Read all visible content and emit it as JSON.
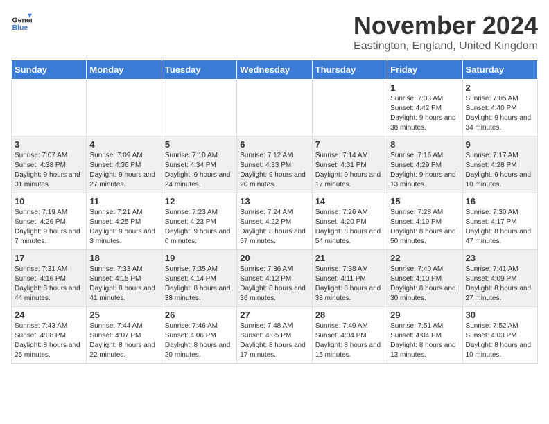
{
  "logo": {
    "line1": "General",
    "line2": "Blue"
  },
  "title": "November 2024",
  "subtitle": "Eastington, England, United Kingdom",
  "days_of_week": [
    "Sunday",
    "Monday",
    "Tuesday",
    "Wednesday",
    "Thursday",
    "Friday",
    "Saturday"
  ],
  "weeks": [
    [
      {
        "day": "",
        "sunrise": "",
        "sunset": "",
        "daylight": ""
      },
      {
        "day": "",
        "sunrise": "",
        "sunset": "",
        "daylight": ""
      },
      {
        "day": "",
        "sunrise": "",
        "sunset": "",
        "daylight": ""
      },
      {
        "day": "",
        "sunrise": "",
        "sunset": "",
        "daylight": ""
      },
      {
        "day": "",
        "sunrise": "",
        "sunset": "",
        "daylight": ""
      },
      {
        "day": "1",
        "sunrise": "Sunrise: 7:03 AM",
        "sunset": "Sunset: 4:42 PM",
        "daylight": "Daylight: 9 hours and 38 minutes."
      },
      {
        "day": "2",
        "sunrise": "Sunrise: 7:05 AM",
        "sunset": "Sunset: 4:40 PM",
        "daylight": "Daylight: 9 hours and 34 minutes."
      }
    ],
    [
      {
        "day": "3",
        "sunrise": "Sunrise: 7:07 AM",
        "sunset": "Sunset: 4:38 PM",
        "daylight": "Daylight: 9 hours and 31 minutes."
      },
      {
        "day": "4",
        "sunrise": "Sunrise: 7:09 AM",
        "sunset": "Sunset: 4:36 PM",
        "daylight": "Daylight: 9 hours and 27 minutes."
      },
      {
        "day": "5",
        "sunrise": "Sunrise: 7:10 AM",
        "sunset": "Sunset: 4:34 PM",
        "daylight": "Daylight: 9 hours and 24 minutes."
      },
      {
        "day": "6",
        "sunrise": "Sunrise: 7:12 AM",
        "sunset": "Sunset: 4:33 PM",
        "daylight": "Daylight: 9 hours and 20 minutes."
      },
      {
        "day": "7",
        "sunrise": "Sunrise: 7:14 AM",
        "sunset": "Sunset: 4:31 PM",
        "daylight": "Daylight: 9 hours and 17 minutes."
      },
      {
        "day": "8",
        "sunrise": "Sunrise: 7:16 AM",
        "sunset": "Sunset: 4:29 PM",
        "daylight": "Daylight: 9 hours and 13 minutes."
      },
      {
        "day": "9",
        "sunrise": "Sunrise: 7:17 AM",
        "sunset": "Sunset: 4:28 PM",
        "daylight": "Daylight: 9 hours and 10 minutes."
      }
    ],
    [
      {
        "day": "10",
        "sunrise": "Sunrise: 7:19 AM",
        "sunset": "Sunset: 4:26 PM",
        "daylight": "Daylight: 9 hours and 7 minutes."
      },
      {
        "day": "11",
        "sunrise": "Sunrise: 7:21 AM",
        "sunset": "Sunset: 4:25 PM",
        "daylight": "Daylight: 9 hours and 3 minutes."
      },
      {
        "day": "12",
        "sunrise": "Sunrise: 7:23 AM",
        "sunset": "Sunset: 4:23 PM",
        "daylight": "Daylight: 9 hours and 0 minutes."
      },
      {
        "day": "13",
        "sunrise": "Sunrise: 7:24 AM",
        "sunset": "Sunset: 4:22 PM",
        "daylight": "Daylight: 8 hours and 57 minutes."
      },
      {
        "day": "14",
        "sunrise": "Sunrise: 7:26 AM",
        "sunset": "Sunset: 4:20 PM",
        "daylight": "Daylight: 8 hours and 54 minutes."
      },
      {
        "day": "15",
        "sunrise": "Sunrise: 7:28 AM",
        "sunset": "Sunset: 4:19 PM",
        "daylight": "Daylight: 8 hours and 50 minutes."
      },
      {
        "day": "16",
        "sunrise": "Sunrise: 7:30 AM",
        "sunset": "Sunset: 4:17 PM",
        "daylight": "Daylight: 8 hours and 47 minutes."
      }
    ],
    [
      {
        "day": "17",
        "sunrise": "Sunrise: 7:31 AM",
        "sunset": "Sunset: 4:16 PM",
        "daylight": "Daylight: 8 hours and 44 minutes."
      },
      {
        "day": "18",
        "sunrise": "Sunrise: 7:33 AM",
        "sunset": "Sunset: 4:15 PM",
        "daylight": "Daylight: 8 hours and 41 minutes."
      },
      {
        "day": "19",
        "sunrise": "Sunrise: 7:35 AM",
        "sunset": "Sunset: 4:14 PM",
        "daylight": "Daylight: 8 hours and 38 minutes."
      },
      {
        "day": "20",
        "sunrise": "Sunrise: 7:36 AM",
        "sunset": "Sunset: 4:12 PM",
        "daylight": "Daylight: 8 hours and 36 minutes."
      },
      {
        "day": "21",
        "sunrise": "Sunrise: 7:38 AM",
        "sunset": "Sunset: 4:11 PM",
        "daylight": "Daylight: 8 hours and 33 minutes."
      },
      {
        "day": "22",
        "sunrise": "Sunrise: 7:40 AM",
        "sunset": "Sunset: 4:10 PM",
        "daylight": "Daylight: 8 hours and 30 minutes."
      },
      {
        "day": "23",
        "sunrise": "Sunrise: 7:41 AM",
        "sunset": "Sunset: 4:09 PM",
        "daylight": "Daylight: 8 hours and 27 minutes."
      }
    ],
    [
      {
        "day": "24",
        "sunrise": "Sunrise: 7:43 AM",
        "sunset": "Sunset: 4:08 PM",
        "daylight": "Daylight: 8 hours and 25 minutes."
      },
      {
        "day": "25",
        "sunrise": "Sunrise: 7:44 AM",
        "sunset": "Sunset: 4:07 PM",
        "daylight": "Daylight: 8 hours and 22 minutes."
      },
      {
        "day": "26",
        "sunrise": "Sunrise: 7:46 AM",
        "sunset": "Sunset: 4:06 PM",
        "daylight": "Daylight: 8 hours and 20 minutes."
      },
      {
        "day": "27",
        "sunrise": "Sunrise: 7:48 AM",
        "sunset": "Sunset: 4:05 PM",
        "daylight": "Daylight: 8 hours and 17 minutes."
      },
      {
        "day": "28",
        "sunrise": "Sunrise: 7:49 AM",
        "sunset": "Sunset: 4:04 PM",
        "daylight": "Daylight: 8 hours and 15 minutes."
      },
      {
        "day": "29",
        "sunrise": "Sunrise: 7:51 AM",
        "sunset": "Sunset: 4:04 PM",
        "daylight": "Daylight: 8 hours and 13 minutes."
      },
      {
        "day": "30",
        "sunrise": "Sunrise: 7:52 AM",
        "sunset": "Sunset: 4:03 PM",
        "daylight": "Daylight: 8 hours and 10 minutes."
      }
    ]
  ]
}
